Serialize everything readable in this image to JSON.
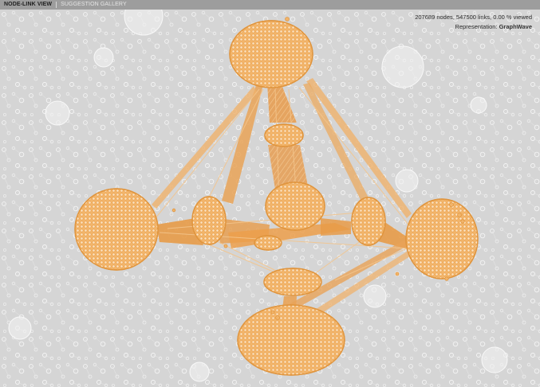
{
  "tabs": [
    {
      "label": "NODE-LINK VIEW",
      "active": true
    },
    {
      "label": "SUGGESTION GALLERY",
      "active": false
    }
  ],
  "stats": {
    "summary": "207689 nodes, 547500 links, 0.00 % viewed",
    "representation_label": "Representation:",
    "representation_value": "GraphWave"
  },
  "colors": {
    "background": "#d5d5d5",
    "topbar": "#9d9d9d",
    "cluster_fill": "#f2b56b",
    "cluster_stroke": "#e0953e",
    "edge_bundle": "#e8a04c",
    "background_nodes": "#f4f4f4"
  }
}
